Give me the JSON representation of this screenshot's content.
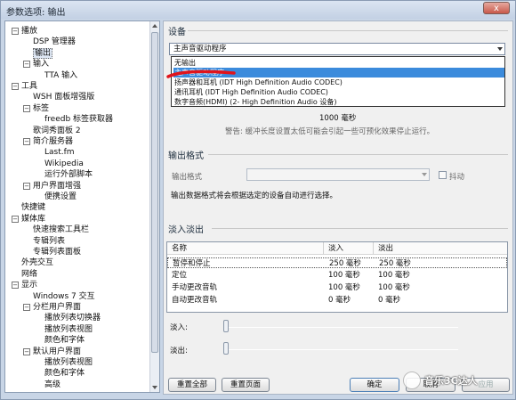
{
  "window": {
    "title": "参数选项: 输出",
    "close_label": "x"
  },
  "tree": {
    "items": [
      {
        "label": "播放",
        "indent": 0,
        "toggle": "−"
      },
      {
        "label": "DSP 管理器",
        "indent": 1
      },
      {
        "label": "输出",
        "indent": 1,
        "selected": true
      },
      {
        "label": "输入",
        "indent": 1,
        "toggle": "−"
      },
      {
        "label": "TTA 输入",
        "indent": 2
      },
      {
        "label": "工具",
        "indent": 0,
        "toggle": "−"
      },
      {
        "label": "WSH 面板增强版",
        "indent": 1
      },
      {
        "label": "标签",
        "indent": 1,
        "toggle": "−"
      },
      {
        "label": "freedb 标签获取器",
        "indent": 2
      },
      {
        "label": "歌词秀面板 2",
        "indent": 1
      },
      {
        "label": "简介服务器",
        "indent": 1,
        "toggle": "−"
      },
      {
        "label": "Last.fm",
        "indent": 2
      },
      {
        "label": "Wikipedia",
        "indent": 2
      },
      {
        "label": "运行外部脚本",
        "indent": 2
      },
      {
        "label": "用户界面增强",
        "indent": 1,
        "toggle": "−"
      },
      {
        "label": "便携设置",
        "indent": 2
      },
      {
        "label": "快捷键",
        "indent": 0
      },
      {
        "label": "媒体库",
        "indent": 0,
        "toggle": "−"
      },
      {
        "label": "快速搜索工具栏",
        "indent": 1
      },
      {
        "label": "专辑列表",
        "indent": 1
      },
      {
        "label": "专辑列表面板",
        "indent": 1
      },
      {
        "label": "外壳交互",
        "indent": 0
      },
      {
        "label": "网络",
        "indent": 0
      },
      {
        "label": "显示",
        "indent": 0,
        "toggle": "−"
      },
      {
        "label": "Windows 7 交互",
        "indent": 1
      },
      {
        "label": "分栏用户界面",
        "indent": 1,
        "toggle": "−"
      },
      {
        "label": "播放列表切换器",
        "indent": 2
      },
      {
        "label": "播放列表视图",
        "indent": 2
      },
      {
        "label": "颜色和字体",
        "indent": 2
      },
      {
        "label": "默认用户界面",
        "indent": 1,
        "toggle": "−"
      },
      {
        "label": "播放列表视图",
        "indent": 2
      },
      {
        "label": "颜色和字体",
        "indent": 2
      },
      {
        "label": "高级",
        "indent": 2
      }
    ]
  },
  "device": {
    "section_title": "设备",
    "selected": "主声音驱动程序",
    "options": [
      "无输出",
      "主声音驱动程序",
      "扬声器和耳机 (IDT High Definition Audio CODEC)",
      "通讯耳机 (IDT High Definition Audio CODEC)",
      "数字音频(HDMI) (2- High Definition Audio 设备)"
    ],
    "buffer_value": "1000 毫秒",
    "warning": "警告: 缓冲长度设置太低可能会引起一些可预化效果停止运行。"
  },
  "format": {
    "section_title": "输出格式",
    "format_label": "输出格式",
    "dither_label": "抖动",
    "note": "输出数据格式将会根据选定的设备自动进行选择。"
  },
  "fade": {
    "section_title": "淡入淡出",
    "columns": [
      "名称",
      "淡入",
      "淡出"
    ],
    "rows": [
      [
        "暂停和停止",
        "250 毫秒",
        "250 毫秒"
      ],
      [
        "定位",
        "100 毫秒",
        "100 毫秒"
      ],
      [
        "手动更改音轨",
        "100 毫秒",
        "100 毫秒"
      ],
      [
        "自动更改音轨",
        "0 毫秒",
        "0 毫秒"
      ]
    ],
    "fade_in_label": "淡入:",
    "fade_out_label": "淡出:",
    "fade_in_level": 0,
    "fade_out_level": 0
  },
  "buttons": {
    "reset_all": "重置全部",
    "reset_page": "重置页面",
    "ok": "确定",
    "cancel": "取消",
    "apply": "应用"
  },
  "watermark": {
    "text": "音乐3C达人"
  },
  "colors": {
    "highlight": "#3b8bdc",
    "annotation_red": "#e0141c"
  }
}
